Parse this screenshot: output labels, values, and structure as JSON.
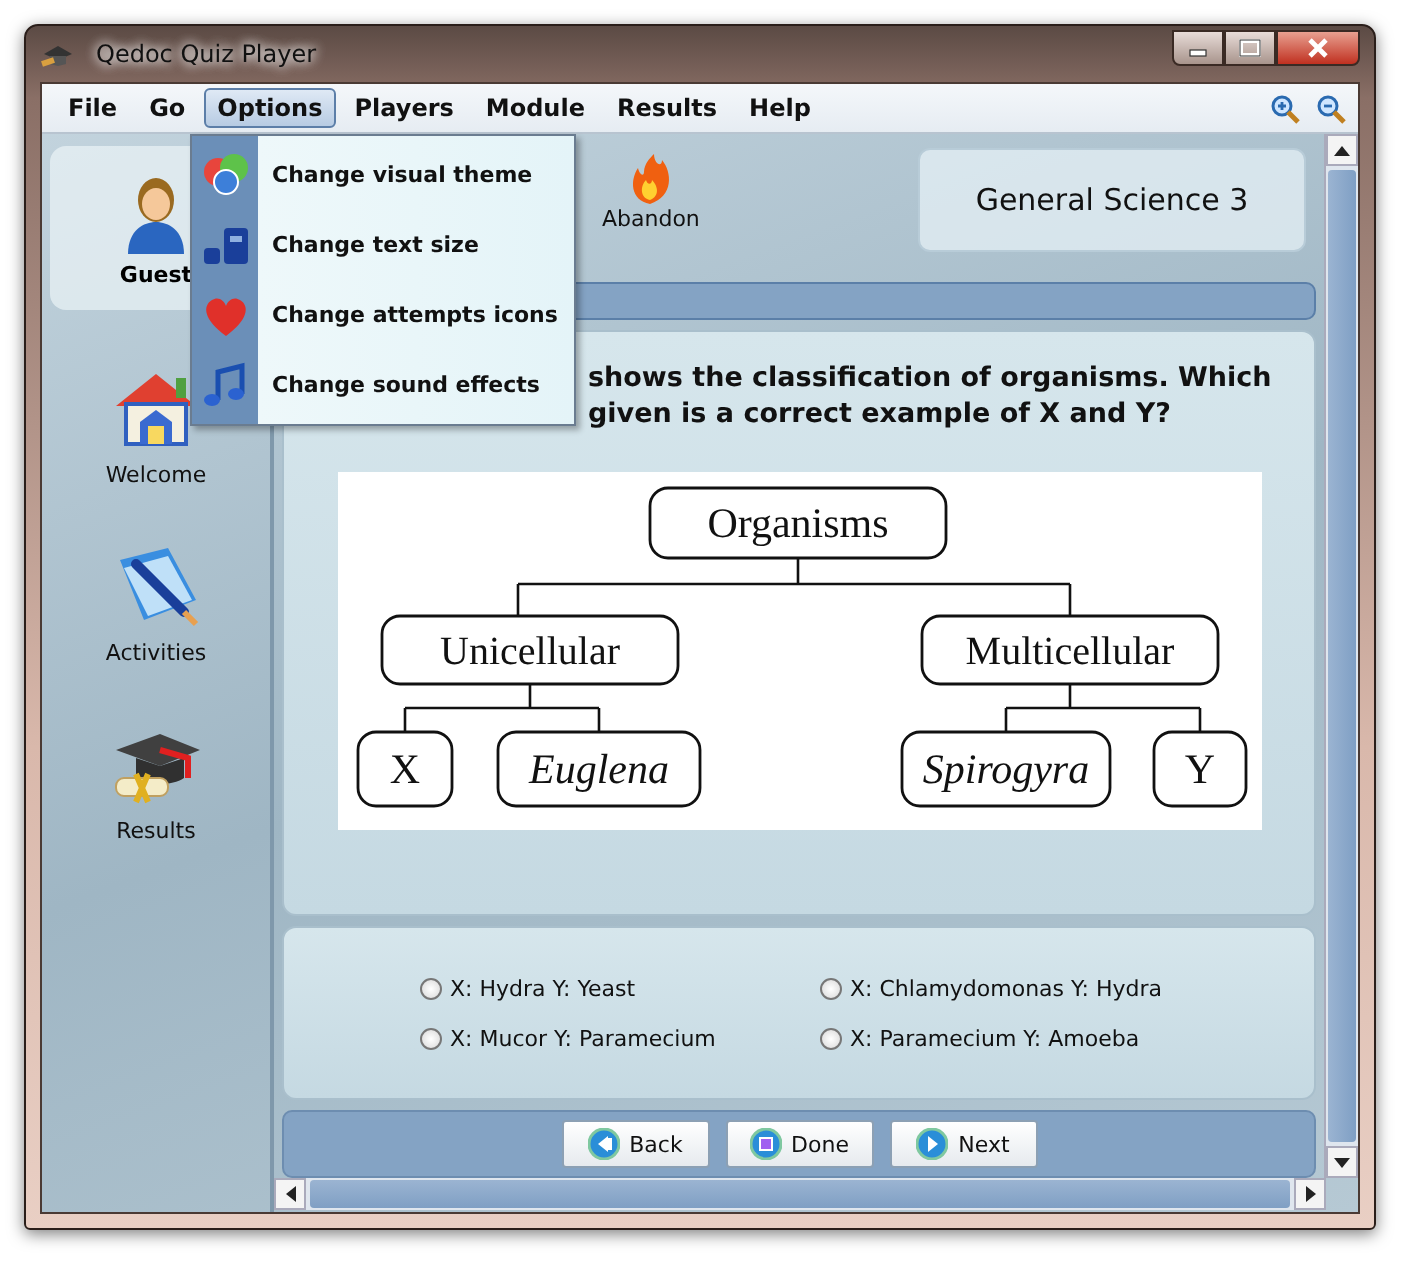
{
  "window": {
    "title": "Qedoc Quiz Player"
  },
  "menu_bar": [
    {
      "label": "File",
      "selected": false
    },
    {
      "label": "Go",
      "selected": false
    },
    {
      "label": "Options",
      "selected": true
    },
    {
      "label": "Players",
      "selected": false
    },
    {
      "label": "Module",
      "selected": false
    },
    {
      "label": "Results",
      "selected": false
    },
    {
      "label": "Help",
      "selected": false
    }
  ],
  "options_menu": [
    {
      "label": "Change visual theme",
      "kind": "theme"
    },
    {
      "label": "Change text size",
      "kind": "text"
    },
    {
      "label": "Change attempts icons",
      "kind": "heart"
    },
    {
      "label": "Change sound effects",
      "kind": "music"
    }
  ],
  "sidebar": {
    "user": "Guest",
    "items": [
      {
        "label": "Welcome",
        "kind": "house"
      },
      {
        "label": "Activities",
        "kind": "book"
      },
      {
        "label": "Results",
        "kind": "cap"
      }
    ]
  },
  "toolbar": [
    {
      "label": "Abandon",
      "kind": "flame"
    }
  ],
  "module_title": "General Science 3",
  "question": {
    "lines": [
      "shows the classification of organisms. Which",
      "given is a correct example of X and Y?"
    ],
    "diagram": {
      "root": "Organisms",
      "groups": [
        {
          "label": "Unicellular",
          "children": [
            {
              "label": "X",
              "italic": false
            },
            {
              "label": "Euglena",
              "italic": true
            }
          ]
        },
        {
          "label": "Multicellular",
          "children": [
            {
              "label": "Spirogyra",
              "italic": true
            },
            {
              "label": "Y",
              "italic": false
            }
          ]
        }
      ]
    }
  },
  "answers": [
    {
      "label": "X: Hydra Y: Yeast",
      "selected": false
    },
    {
      "label": "X: Chlamydomonas Y: Hydra",
      "selected": false
    },
    {
      "label": "X: Mucor Y: Paramecium",
      "selected": false
    },
    {
      "label": "X: Paramecium Y: Amoeba",
      "selected": false
    }
  ],
  "buttons": [
    {
      "label": "Back",
      "kind": "back"
    },
    {
      "label": "Done",
      "kind": "done"
    },
    {
      "label": "Next",
      "kind": "next"
    }
  ]
}
